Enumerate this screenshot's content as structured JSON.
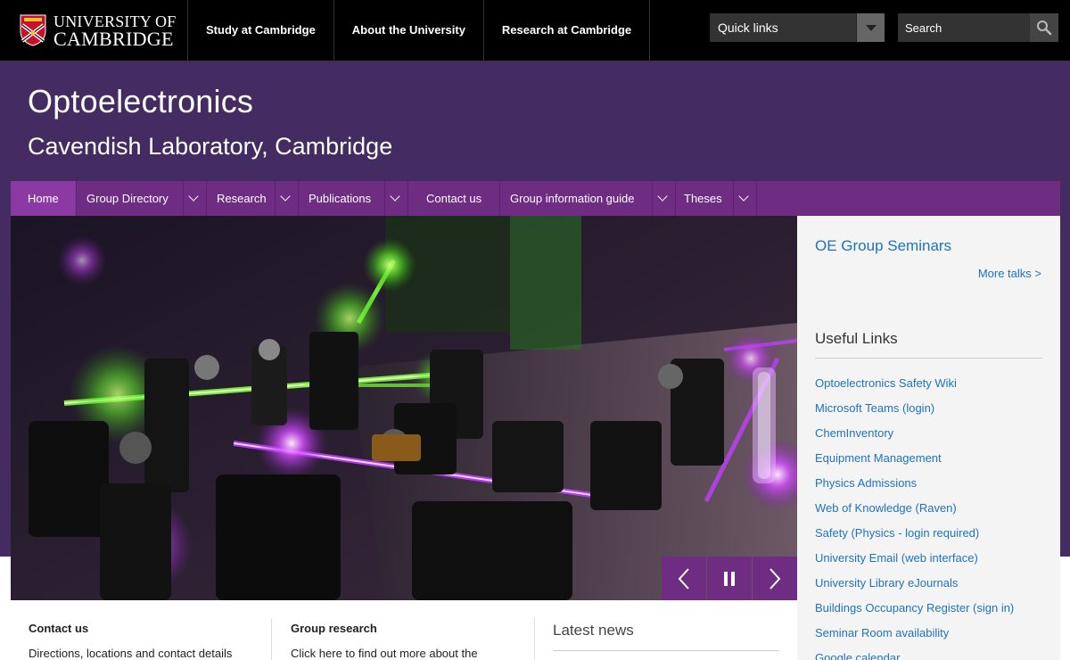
{
  "brand": {
    "line1": "UNIVERSITY OF",
    "line2": "CAMBRIDGE"
  },
  "topnav": [
    {
      "label": "Study at Cambridge"
    },
    {
      "label": "About the University"
    },
    {
      "label": "Research at Cambridge"
    }
  ],
  "quick_links": {
    "label": "Quick links"
  },
  "search": {
    "placeholder": "Search"
  },
  "site": {
    "title": "Optoelectronics",
    "subtitle": "Cavendish Laboratory, Cambridge"
  },
  "secnav": [
    {
      "label": "Home",
      "active": true,
      "has_dropdown": false
    },
    {
      "label": "Group Directory",
      "has_dropdown": true
    },
    {
      "label": "Research",
      "has_dropdown": true
    },
    {
      "label": "Publications",
      "has_dropdown": true
    },
    {
      "label": "Contact us",
      "has_dropdown": false
    },
    {
      "label": "Group information guide",
      "has_dropdown": true
    },
    {
      "label": "Theses",
      "has_dropdown": true
    }
  ],
  "carousel": {
    "controls": [
      "chevron-left-icon",
      "pause-icon",
      "chevron-right-icon"
    ]
  },
  "sidebar": {
    "seminars_title": "OE Group Seminars",
    "more_talks": "More talks >",
    "useful_title": "Useful Links",
    "links": [
      "Optoelectronics Safety Wiki",
      "Microsoft Teams (login)",
      "ChemInventory",
      "Equipment Management",
      "Physics Admissions",
      "Web of Knowledge (Raven)",
      "Safety (Physics - login required)",
      "University Email (web interface)",
      "University Library eJournals",
      "Buildings Occupancy Register (sign in)",
      "Seminar Room availability",
      "Google calendar"
    ]
  },
  "cards": {
    "contact_title": "Contact us",
    "contact_text": "Directions, locations and contact details",
    "research_title": "Group research",
    "research_text": "Click here to find out more about the",
    "news_title": "Latest news"
  },
  "colors": {
    "top_bar": "#000000",
    "header_purple": "#442b62",
    "nav_purple": "#6e2c83",
    "nav_active": "#8c3aa3",
    "link_blue": "#1e73be",
    "sidebar_bg": "#f4f4f4"
  }
}
